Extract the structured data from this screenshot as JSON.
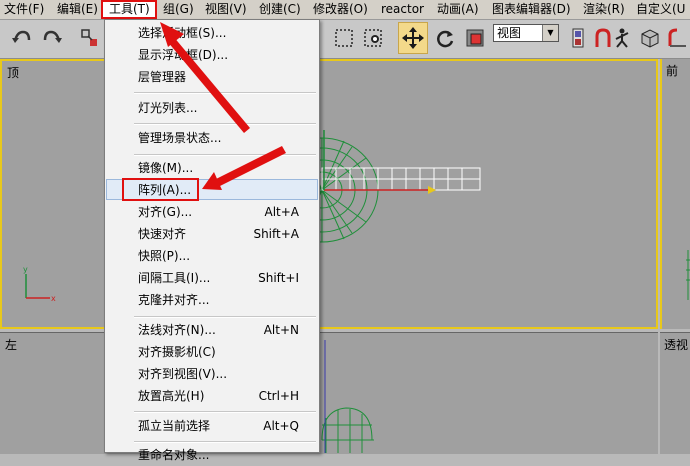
{
  "menubar": {
    "file": "文件(F)",
    "edit": "编辑(E)",
    "tools": "工具(T)",
    "group": "组(G)",
    "views": "视图(V)",
    "create": "创建(C)",
    "modifiers": "修改器(O)",
    "reactor": "reactor",
    "animation": "动画(A)",
    "graph_editors": "图表编辑器(D)",
    "rendering": "渲染(R)",
    "customize": "自定义(U"
  },
  "toolbar": {
    "view_select": {
      "value": "视图"
    }
  },
  "viewports": {
    "top": "顶",
    "front": "前",
    "left": "左",
    "perspective": "透视"
  },
  "tools_menu": {
    "items": [
      {
        "label": "选择浮动框(S)...",
        "shortcut": ""
      },
      {
        "label": "显示浮动框(D)...",
        "shortcut": ""
      },
      {
        "label": "层管理器",
        "shortcut": ""
      },
      {
        "label": "灯光列表...",
        "shortcut": ""
      },
      {
        "label": "管理场景状态...",
        "shortcut": ""
      },
      {
        "label": "镜像(M)...",
        "shortcut": ""
      },
      {
        "label": "阵列(A)...",
        "shortcut": ""
      },
      {
        "label": "对齐(G)...",
        "shortcut": "Alt+A"
      },
      {
        "label": "快速对齐",
        "shortcut": "Shift+A"
      },
      {
        "label": "快照(P)...",
        "shortcut": ""
      },
      {
        "label": "间隔工具(I)...",
        "shortcut": "Shift+I"
      },
      {
        "label": "克隆并对齐...",
        "shortcut": ""
      },
      {
        "label": "法线对齐(N)...",
        "shortcut": "Alt+N"
      },
      {
        "label": "对齐摄影机(C)",
        "shortcut": ""
      },
      {
        "label": "对齐到视图(V)...",
        "shortcut": ""
      },
      {
        "label": "放置高光(H)",
        "shortcut": "Ctrl+H"
      },
      {
        "label": "孤立当前选择",
        "shortcut": "Alt+Q"
      },
      {
        "label": "重命名对象...",
        "shortcut": ""
      }
    ]
  },
  "colors": {
    "highlight_box": "#e01010",
    "annotation_arrow": "#e01010",
    "active_viewport_border": "#e8c81a",
    "wireframe": "#1f8f3a",
    "selected_grid": "#ffffff"
  }
}
